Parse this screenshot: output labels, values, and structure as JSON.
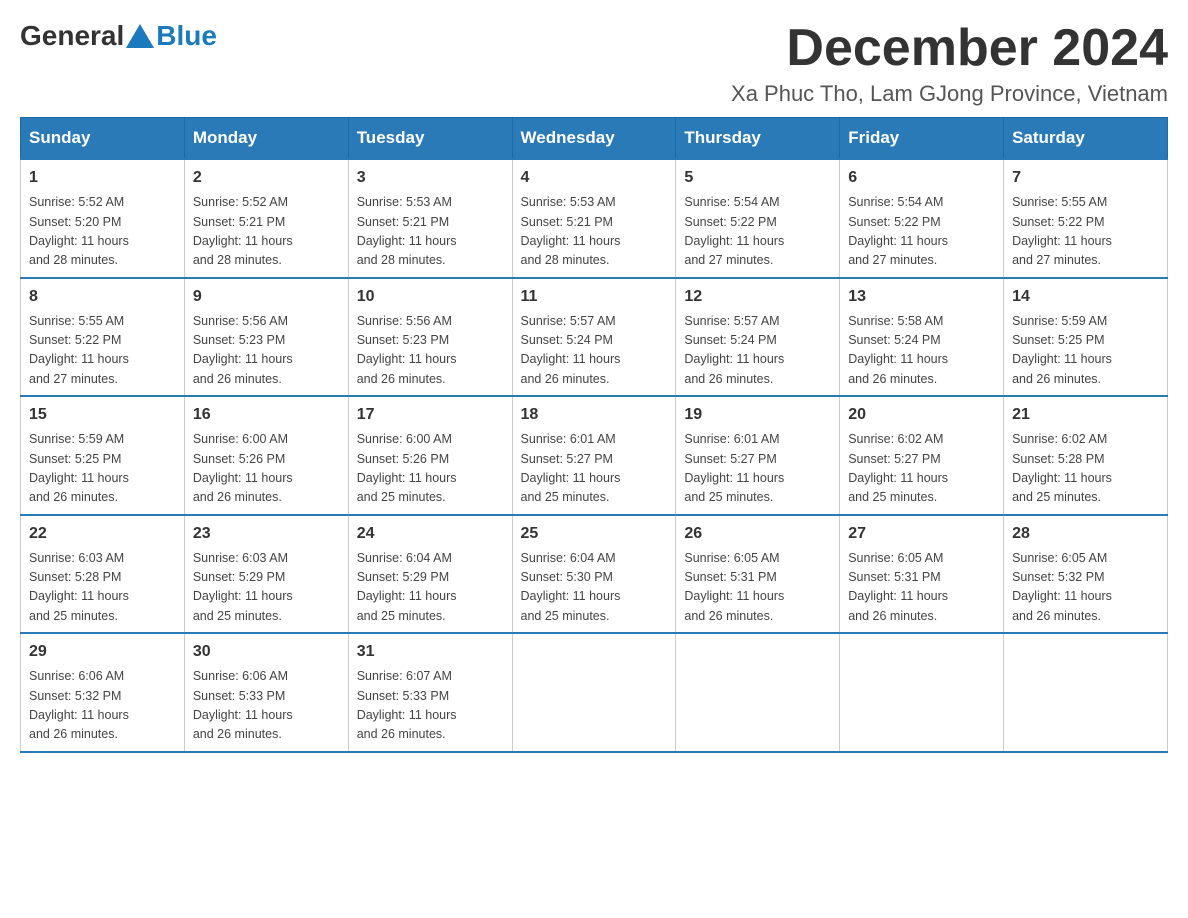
{
  "logo": {
    "general": "General",
    "blue": "Blue"
  },
  "title": "December 2024",
  "location": "Xa Phuc Tho, Lam GJong Province, Vietnam",
  "headers": [
    "Sunday",
    "Monday",
    "Tuesday",
    "Wednesday",
    "Thursday",
    "Friday",
    "Saturday"
  ],
  "weeks": [
    [
      {
        "day": "1",
        "info": "Sunrise: 5:52 AM\nSunset: 5:20 PM\nDaylight: 11 hours\nand 28 minutes."
      },
      {
        "day": "2",
        "info": "Sunrise: 5:52 AM\nSunset: 5:21 PM\nDaylight: 11 hours\nand 28 minutes."
      },
      {
        "day": "3",
        "info": "Sunrise: 5:53 AM\nSunset: 5:21 PM\nDaylight: 11 hours\nand 28 minutes."
      },
      {
        "day": "4",
        "info": "Sunrise: 5:53 AM\nSunset: 5:21 PM\nDaylight: 11 hours\nand 28 minutes."
      },
      {
        "day": "5",
        "info": "Sunrise: 5:54 AM\nSunset: 5:22 PM\nDaylight: 11 hours\nand 27 minutes."
      },
      {
        "day": "6",
        "info": "Sunrise: 5:54 AM\nSunset: 5:22 PM\nDaylight: 11 hours\nand 27 minutes."
      },
      {
        "day": "7",
        "info": "Sunrise: 5:55 AM\nSunset: 5:22 PM\nDaylight: 11 hours\nand 27 minutes."
      }
    ],
    [
      {
        "day": "8",
        "info": "Sunrise: 5:55 AM\nSunset: 5:22 PM\nDaylight: 11 hours\nand 27 minutes."
      },
      {
        "day": "9",
        "info": "Sunrise: 5:56 AM\nSunset: 5:23 PM\nDaylight: 11 hours\nand 26 minutes."
      },
      {
        "day": "10",
        "info": "Sunrise: 5:56 AM\nSunset: 5:23 PM\nDaylight: 11 hours\nand 26 minutes."
      },
      {
        "day": "11",
        "info": "Sunrise: 5:57 AM\nSunset: 5:24 PM\nDaylight: 11 hours\nand 26 minutes."
      },
      {
        "day": "12",
        "info": "Sunrise: 5:57 AM\nSunset: 5:24 PM\nDaylight: 11 hours\nand 26 minutes."
      },
      {
        "day": "13",
        "info": "Sunrise: 5:58 AM\nSunset: 5:24 PM\nDaylight: 11 hours\nand 26 minutes."
      },
      {
        "day": "14",
        "info": "Sunrise: 5:59 AM\nSunset: 5:25 PM\nDaylight: 11 hours\nand 26 minutes."
      }
    ],
    [
      {
        "day": "15",
        "info": "Sunrise: 5:59 AM\nSunset: 5:25 PM\nDaylight: 11 hours\nand 26 minutes."
      },
      {
        "day": "16",
        "info": "Sunrise: 6:00 AM\nSunset: 5:26 PM\nDaylight: 11 hours\nand 26 minutes."
      },
      {
        "day": "17",
        "info": "Sunrise: 6:00 AM\nSunset: 5:26 PM\nDaylight: 11 hours\nand 25 minutes."
      },
      {
        "day": "18",
        "info": "Sunrise: 6:01 AM\nSunset: 5:27 PM\nDaylight: 11 hours\nand 25 minutes."
      },
      {
        "day": "19",
        "info": "Sunrise: 6:01 AM\nSunset: 5:27 PM\nDaylight: 11 hours\nand 25 minutes."
      },
      {
        "day": "20",
        "info": "Sunrise: 6:02 AM\nSunset: 5:27 PM\nDaylight: 11 hours\nand 25 minutes."
      },
      {
        "day": "21",
        "info": "Sunrise: 6:02 AM\nSunset: 5:28 PM\nDaylight: 11 hours\nand 25 minutes."
      }
    ],
    [
      {
        "day": "22",
        "info": "Sunrise: 6:03 AM\nSunset: 5:28 PM\nDaylight: 11 hours\nand 25 minutes."
      },
      {
        "day": "23",
        "info": "Sunrise: 6:03 AM\nSunset: 5:29 PM\nDaylight: 11 hours\nand 25 minutes."
      },
      {
        "day": "24",
        "info": "Sunrise: 6:04 AM\nSunset: 5:29 PM\nDaylight: 11 hours\nand 25 minutes."
      },
      {
        "day": "25",
        "info": "Sunrise: 6:04 AM\nSunset: 5:30 PM\nDaylight: 11 hours\nand 25 minutes."
      },
      {
        "day": "26",
        "info": "Sunrise: 6:05 AM\nSunset: 5:31 PM\nDaylight: 11 hours\nand 26 minutes."
      },
      {
        "day": "27",
        "info": "Sunrise: 6:05 AM\nSunset: 5:31 PM\nDaylight: 11 hours\nand 26 minutes."
      },
      {
        "day": "28",
        "info": "Sunrise: 6:05 AM\nSunset: 5:32 PM\nDaylight: 11 hours\nand 26 minutes."
      }
    ],
    [
      {
        "day": "29",
        "info": "Sunrise: 6:06 AM\nSunset: 5:32 PM\nDaylight: 11 hours\nand 26 minutes."
      },
      {
        "day": "30",
        "info": "Sunrise: 6:06 AM\nSunset: 5:33 PM\nDaylight: 11 hours\nand 26 minutes."
      },
      {
        "day": "31",
        "info": "Sunrise: 6:07 AM\nSunset: 5:33 PM\nDaylight: 11 hours\nand 26 minutes."
      },
      null,
      null,
      null,
      null
    ]
  ]
}
